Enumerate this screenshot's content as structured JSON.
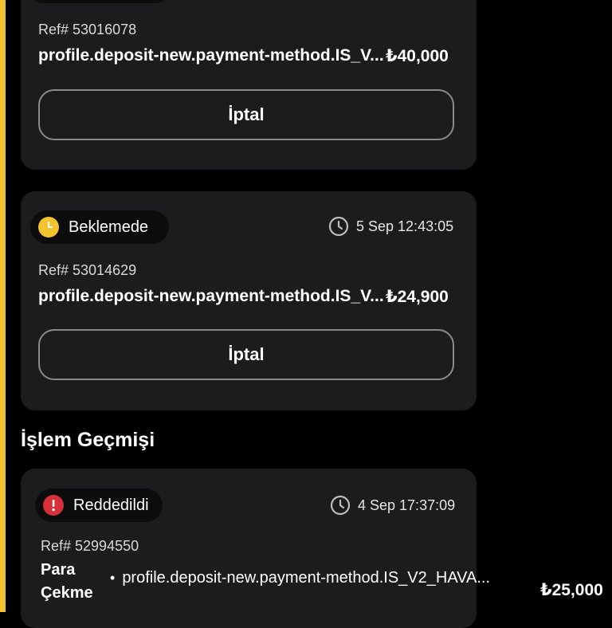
{
  "pending": [
    {
      "ref": "Ref# 53016078",
      "method": "profile.deposit-new.payment-method.IS_V...",
      "amount": "₺40,000",
      "cancel_label": "İptal"
    },
    {
      "status": "Beklemede",
      "time": "5 Sep 12:43:05",
      "ref": "Ref# 53014629",
      "method": "profile.deposit-new.payment-method.IS_V...",
      "amount": "₺24,900",
      "cancel_label": "İptal"
    }
  ],
  "history": {
    "title": "İşlem Geçmişi",
    "items": [
      {
        "status": "Reddedildi",
        "time": "4 Sep 17:37:09",
        "ref": "Ref# 52994550",
        "type_line1": "Para",
        "type_line2": "Çekme",
        "bullet": "•",
        "method": "profile.deposit-new.payment-method.IS_V2_HAVA...",
        "amount": "₺25,000"
      }
    ]
  },
  "colors": {
    "accent": "#f4c430",
    "card_bg": "#1c1c1e",
    "pending_status": "#f4c430",
    "rejected_status": "#d7303a"
  },
  "icons": {
    "pending": "clock-status-icon",
    "rejected": "exclamation-icon",
    "time": "clock-icon"
  }
}
